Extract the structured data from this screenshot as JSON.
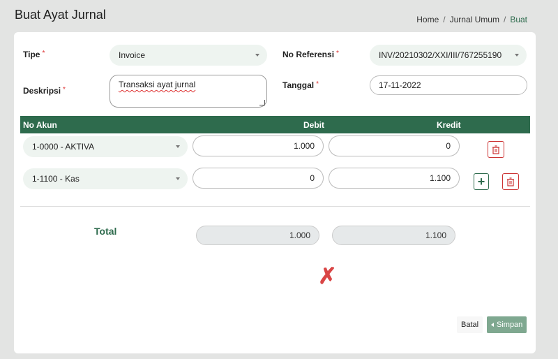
{
  "header": {
    "title": "Buat Ayat Jurnal",
    "breadcrumb": [
      {
        "label": "Home"
      },
      {
        "label": "Jurnal Umum"
      },
      {
        "label": "Buat"
      }
    ],
    "breadcrumb_sep": "/"
  },
  "form": {
    "tipe_label": "Tipe",
    "tipe_value": "Invoice",
    "no_ref_label": "No Referensi",
    "no_ref_value": "INV/20210302/XXI/III/767255190",
    "deskripsi_label": "Deskripsi",
    "deskripsi_value": "Transaksi ayat jurnal",
    "tanggal_label": "Tanggal",
    "tanggal_value": "17-11-2022",
    "required_mark": "*"
  },
  "table": {
    "headers": {
      "akun": "No Akun",
      "debit": "Debit",
      "kredit": "Kredit"
    },
    "rows": [
      {
        "akun": "1-0000 - AKTIVA",
        "debit": "1.000",
        "kredit": "0"
      },
      {
        "akun": "1-1100 - Kas",
        "debit": "0",
        "kredit": "1.100"
      }
    ],
    "add_label": "+"
  },
  "totals": {
    "label": "Total",
    "debit": "1.000",
    "kredit": "1.100"
  },
  "status": {
    "mismatch_mark": "✗"
  },
  "actions": {
    "batal": "Batal",
    "simpan": "Simpan"
  },
  "colors": {
    "brand": "#2e6b4d",
    "danger": "#d94545"
  }
}
